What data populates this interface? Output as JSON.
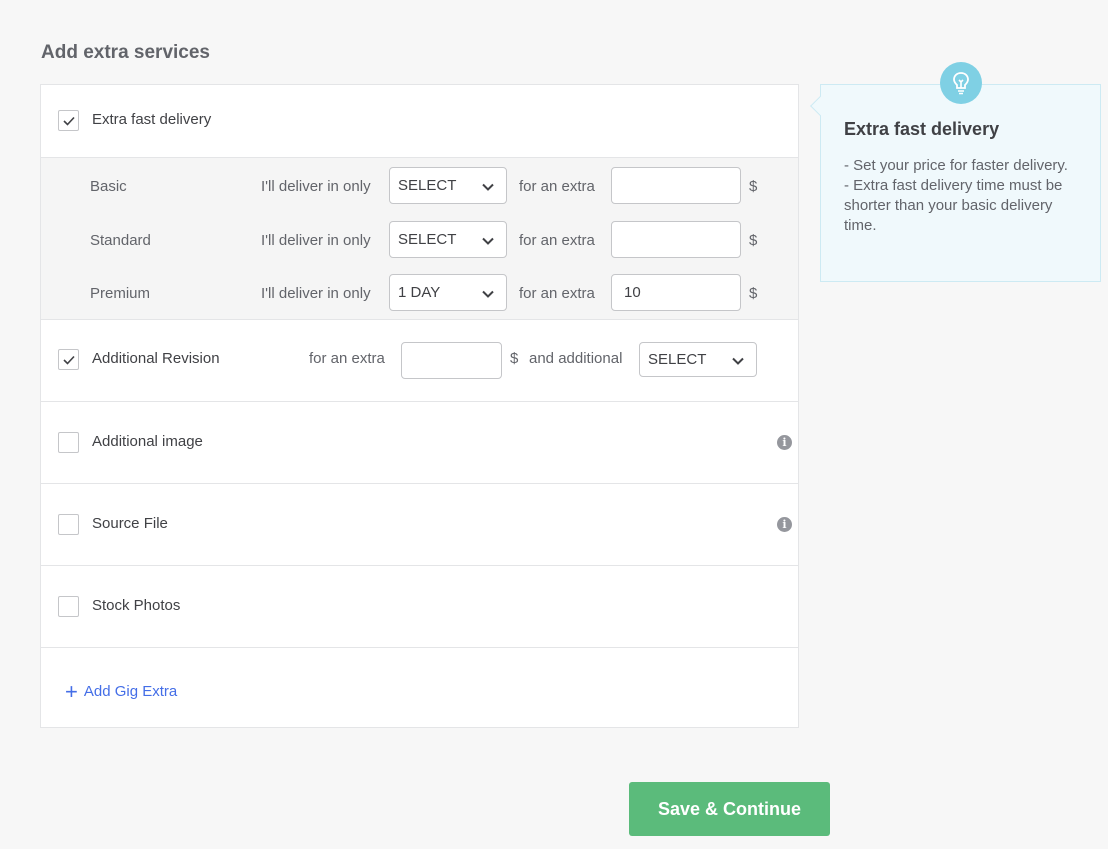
{
  "section_title": "Add extra services",
  "fast_delivery": {
    "label": "Extra fast delivery",
    "checked": true,
    "tiers": [
      {
        "name": "Basic",
        "deliver_text": "I'll deliver in only",
        "select_value": "SELECT",
        "extra_text": "for an extra",
        "price": "",
        "currency": "$"
      },
      {
        "name": "Standard",
        "deliver_text": "I'll deliver in only",
        "select_value": "SELECT",
        "extra_text": "for an extra",
        "price": "",
        "currency": "$"
      },
      {
        "name": "Premium",
        "deliver_text": "I'll deliver in only",
        "select_value": "1 DAY",
        "extra_text": "for an extra",
        "price": "10",
        "currency": "$"
      }
    ]
  },
  "additional_revision": {
    "label": "Additional Revision",
    "checked": true,
    "extra_text": "for an extra",
    "price": "",
    "currency": "$",
    "additional_text": "and additional",
    "select_value": "SELECT"
  },
  "additional_image": {
    "label": "Additional image",
    "checked": false
  },
  "source_file": {
    "label": "Source File",
    "checked": false
  },
  "stock_photos": {
    "label": "Stock Photos",
    "checked": false
  },
  "add_gig_extra": {
    "icon": "+",
    "label": "Add Gig Extra"
  },
  "tip": {
    "title": "Extra fast delivery",
    "line1": "- Set your price for faster delivery.",
    "line2": "- Extra fast delivery time must be shorter than your basic delivery time."
  },
  "save_button": "Save & Continue",
  "colors": {
    "accent_green": "#5bbb7b",
    "link_blue": "#446ee7",
    "tip_bg": "#f0f9fc",
    "bulb": "#7fd0e4"
  },
  "icons": {
    "check": "checkmark-icon",
    "chevron": "chevron-down-icon",
    "info": "info-icon",
    "bulb": "lightbulb-icon"
  }
}
